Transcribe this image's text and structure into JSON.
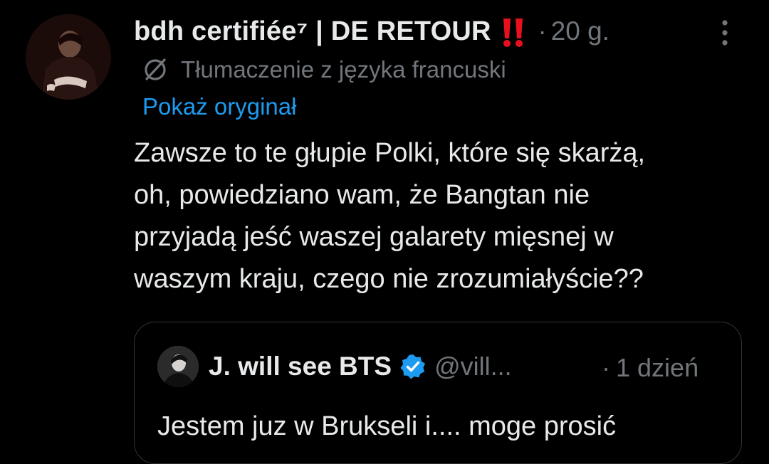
{
  "tweet": {
    "author": {
      "display_name": "bdh certifiée⁷ | DE RETOUR",
      "name_emoji_icon": "double-exclamation-icon",
      "avatar_icon": "avatar"
    },
    "meta_separator": "·",
    "time": "20 g.",
    "more_icon": "vertical-ellipsis-icon",
    "translation": {
      "icon": "globe-icon",
      "label": "Tłumaczenie z języka francuski",
      "show_original": "Pokaż oryginał"
    },
    "text_lines": [
      "Zawsze to te głupie Polki, które się skarżą,",
      "oh, powiedziano wam, że Bangtan nie",
      "przyjadą jeść waszej galarety mięsnej w",
      "waszym kraju, czego nie zrozumiałyście??"
    ]
  },
  "quote": {
    "display_name": "J. will see BTS",
    "verified_icon": "verified-badge-icon",
    "handle": "@vill...",
    "meta_separator": "·",
    "time": "1 dzień",
    "text": "Jestem juz w Brukseli i.... moge prosić"
  },
  "colors": {
    "background": "#000000",
    "primary_text": "#e7e9ea",
    "secondary_text": "#71767b",
    "link": "#1d9bf0",
    "border": "#2f3336",
    "emoji_red": "#e8101f"
  }
}
